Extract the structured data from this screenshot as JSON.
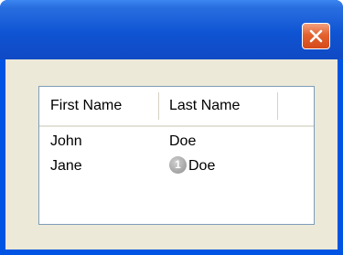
{
  "window": {
    "close_icon": "close-x-icon",
    "colors": {
      "title_bar": "#0f54d3",
      "close_button": "#e3622f",
      "client_area": "#ece9d8",
      "list_border": "#7f9db9"
    }
  },
  "list": {
    "columns": [
      "First Name",
      "Last Name"
    ],
    "rows": [
      {
        "first": "John",
        "last": "Doe"
      },
      {
        "first": "Jane",
        "last": "Doe",
        "badge": "1"
      }
    ]
  }
}
